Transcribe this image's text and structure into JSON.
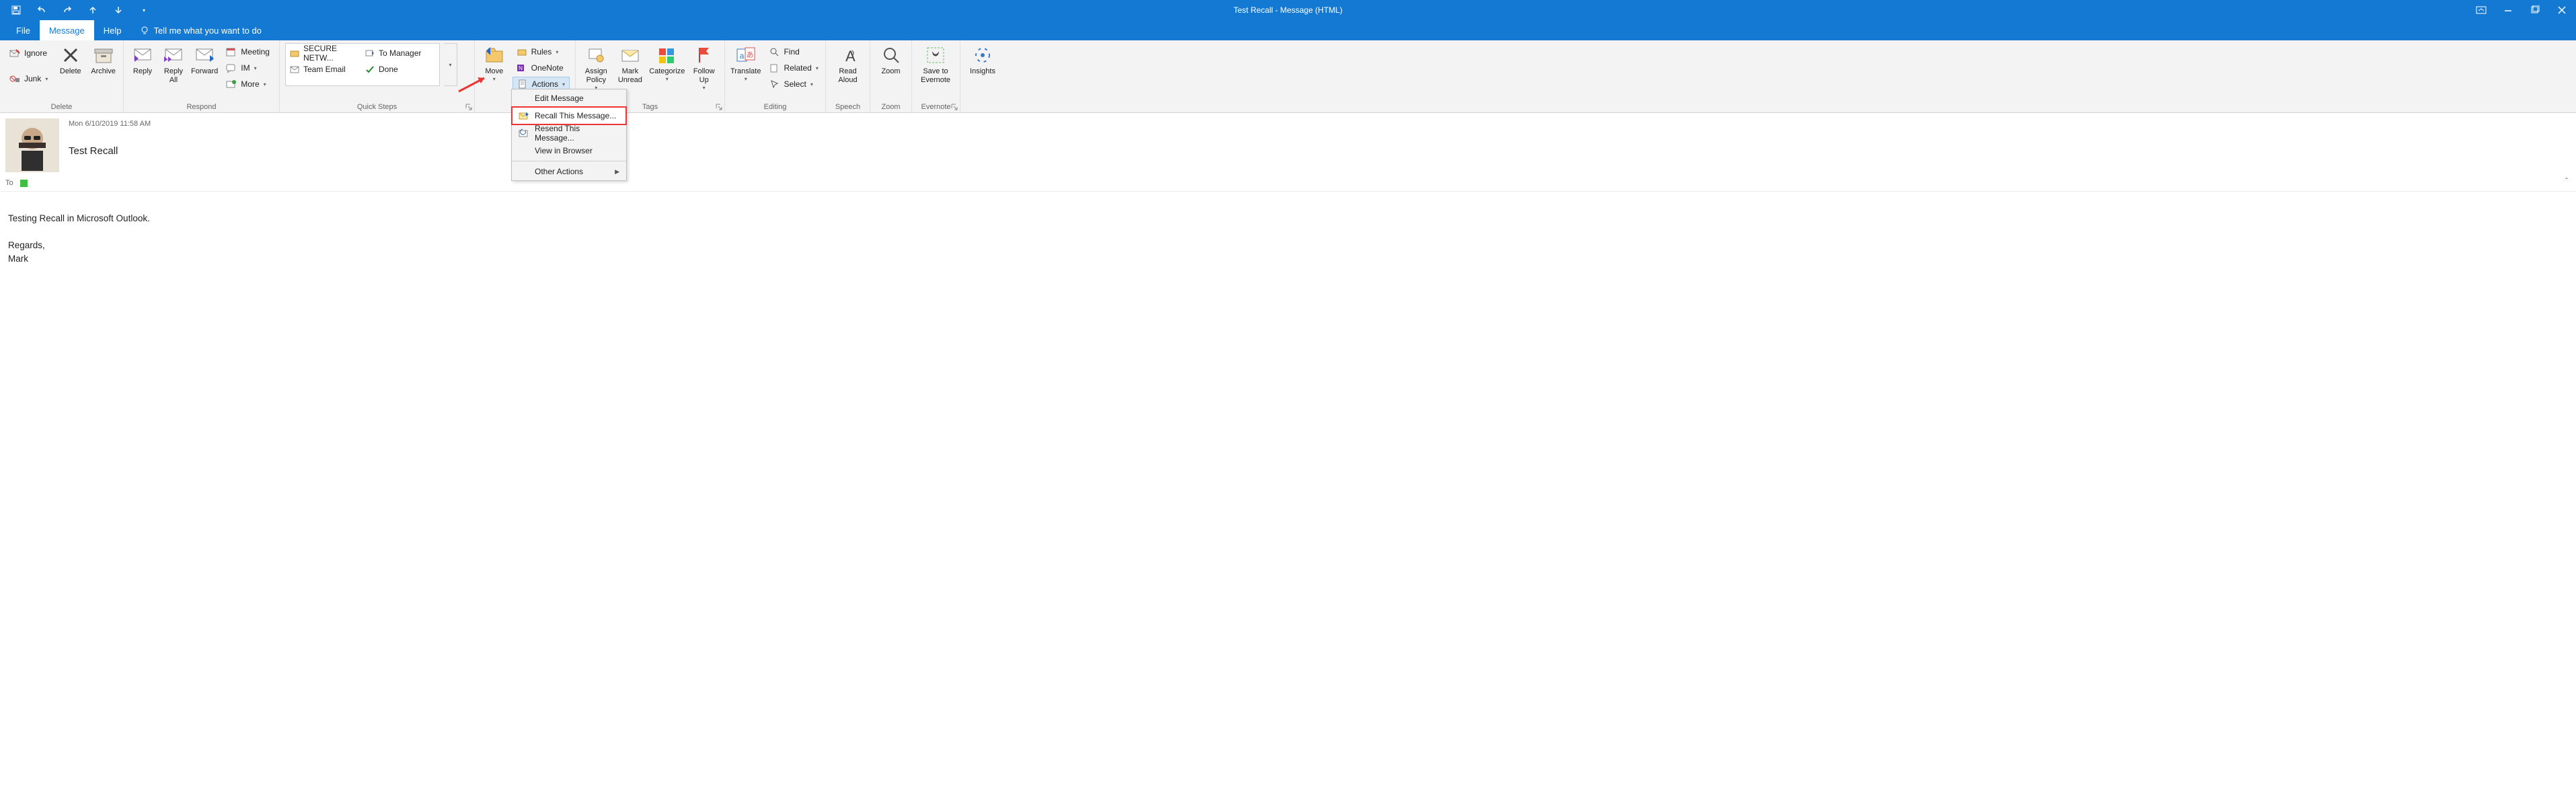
{
  "window": {
    "title": "Test Recall   -  Message (HTML)"
  },
  "tabs": {
    "file": "File",
    "message": "Message",
    "help": "Help",
    "tellme": "Tell me what you want to do"
  },
  "ribbon": {
    "delete_group": {
      "ignore": "Ignore",
      "junk": "Junk",
      "delete": "Delete",
      "archive": "Archive",
      "label": "Delete"
    },
    "respond_group": {
      "reply": "Reply",
      "reply_all": "Reply\nAll",
      "forward": "Forward",
      "meeting": "Meeting",
      "im": "IM",
      "more": "More",
      "label": "Respond"
    },
    "quicksteps_group": {
      "items": [
        "SECURE NETW...",
        "To Manager",
        "Team Email",
        "Done"
      ],
      "label": "Quick Steps"
    },
    "move_group": {
      "move": "Move",
      "rules": "Rules",
      "onenote": "OneNote",
      "actions": "Actions",
      "label": "Move",
      "actions_menu": {
        "edit": "Edit Message",
        "recall": "Recall This Message...",
        "resend": "Resend This Message...",
        "view": "View in Browser",
        "other": "Other Actions"
      }
    },
    "tags_group": {
      "assign_policy": "Assign\nPolicy",
      "mark_unread": "Mark\nUnread",
      "categorize": "Categorize",
      "follow_up": "Follow\nUp",
      "label": "Tags"
    },
    "editing_group": {
      "translate": "Translate",
      "find": "Find",
      "related": "Related",
      "select": "Select",
      "label": "Editing"
    },
    "speech_group": {
      "read_aloud": "Read\nAloud",
      "label": "Speech"
    },
    "zoom_group": {
      "zoom": "Zoom",
      "label": "Zoom"
    },
    "evernote_group": {
      "save": "Save to\nEvernote",
      "label": "Evernote"
    },
    "insights_group": {
      "insights": "Insights"
    }
  },
  "message": {
    "date": "Mon 6/10/2019 11:58 AM",
    "subject": "Test Recall",
    "to_label": "To",
    "body_line1": "Testing Recall in Microsoft Outlook.",
    "body_line2": "Regards,",
    "body_line3": "Mark"
  }
}
